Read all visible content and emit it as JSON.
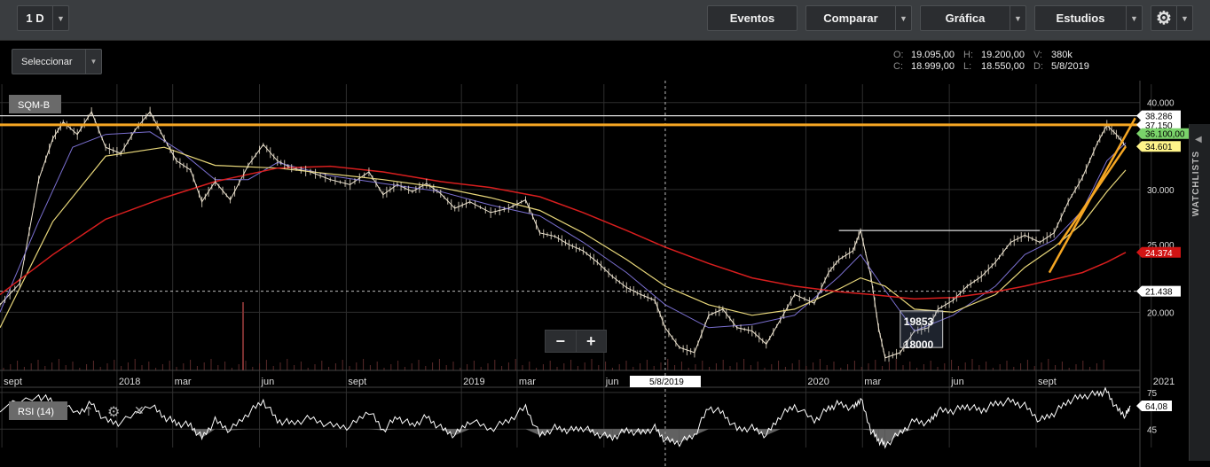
{
  "toolbar": {
    "interval": "1 D",
    "events": "Eventos",
    "compare": "Comparar",
    "chart": "Gráfica",
    "studies": "Estudios"
  },
  "selector": {
    "label": "Seleccionar"
  },
  "ohlc": {
    "o_label": "O:",
    "o": "19.095,00",
    "h_label": "H:",
    "h": "19.200,00",
    "v_label": "V:",
    "v": "380k",
    "c_label": "C:",
    "c": "18.999,00",
    "l_label": "L:",
    "l": "18.550,00",
    "d_label": "D:",
    "d": "5/8/2019"
  },
  "sidebar": {
    "label": "WATCHLISTS"
  },
  "colors": {
    "background": "#000000",
    "price": "#f0e6d2",
    "ma_short": "#7a6fd0",
    "ma_mid": "#e8d77a",
    "ma_long": "#d81e1e",
    "resistance": "#f5a623",
    "white_line": "#e0e0e0",
    "rsi_line": "#ffffff",
    "rsi_fill": "#8a8a8a"
  },
  "chart_data": {
    "type": "line",
    "symbol": "SQM-B",
    "y_ticks": [
      "40.000",
      "30.000",
      "25.000",
      "20.000"
    ],
    "y_tick_values": [
      40000,
      30000,
      25000,
      20000
    ],
    "ylim": [
      16500,
      42500
    ],
    "y_scale": "log",
    "x_ticks": [
      "sept",
      "2018",
      "mar",
      "jun",
      "sept",
      "2019",
      "mar",
      "jun",
      "2020",
      "mar",
      "jun",
      "sept",
      "2021"
    ],
    "x_tick_dates": [
      "2017-09-01",
      "2018-01-01",
      "2018-03-01",
      "2018-06-01",
      "2018-09-01",
      "2019-01-01",
      "2019-03-01",
      "2019-06-01",
      "2020-01-01",
      "2020-03-01",
      "2020-06-01",
      "2020-09-01",
      "2021-01-01"
    ],
    "xlim": [
      "2017-08-30",
      "2020-12-20"
    ],
    "crosshair": {
      "date": "5/8/2019",
      "value": "21.438"
    },
    "labels": [
      {
        "text": "38.286",
        "value": 38286,
        "style": "white"
      },
      {
        "text": "37.150",
        "value": 37150,
        "style": "white"
      },
      {
        "text": "36.100,00",
        "value": 36100,
        "style": "green"
      },
      {
        "text": "34.601",
        "value": 34601,
        "style": "yellow"
      },
      {
        "text": "24.374",
        "value": 24374,
        "style": "red"
      },
      {
        "text": "21.438",
        "value": 21438,
        "style": "white"
      }
    ],
    "series": [
      {
        "points": [
          [
            "2017-08-30",
            20500
          ],
          [
            "2017-09-20",
            22000
          ],
          [
            "2017-10-10",
            31000
          ],
          [
            "2017-10-25",
            35500
          ],
          [
            "2017-11-05",
            37500
          ],
          [
            "2017-11-20",
            36000
          ],
          [
            "2017-12-05",
            38800
          ],
          [
            "2017-12-20",
            34500
          ],
          [
            "2018-01-05",
            33800
          ],
          [
            "2018-01-20",
            36500
          ],
          [
            "2018-02-05",
            38800
          ],
          [
            "2018-02-20",
            35500
          ],
          [
            "2018-03-05",
            33000
          ],
          [
            "2018-03-20",
            32000
          ],
          [
            "2018-04-01",
            28800
          ],
          [
            "2018-04-15",
            30800
          ],
          [
            "2018-05-01",
            29000
          ],
          [
            "2018-05-20",
            32500
          ],
          [
            "2018-06-05",
            34800
          ],
          [
            "2018-06-20",
            33000
          ],
          [
            "2018-07-05",
            32200
          ],
          [
            "2018-07-25",
            31800
          ],
          [
            "2018-08-15",
            31000
          ],
          [
            "2018-09-05",
            30500
          ],
          [
            "2018-09-25",
            31800
          ],
          [
            "2018-10-10",
            29500
          ],
          [
            "2018-10-25",
            30500
          ],
          [
            "2018-11-10",
            29800
          ],
          [
            "2018-11-25",
            30600
          ],
          [
            "2018-12-10",
            29600
          ],
          [
            "2018-12-25",
            28200
          ],
          [
            "2019-01-10",
            28800
          ],
          [
            "2019-02-01",
            27800
          ],
          [
            "2019-02-20",
            28200
          ],
          [
            "2019-03-10",
            29000
          ],
          [
            "2019-03-25",
            26000
          ],
          [
            "2019-04-10",
            25700
          ],
          [
            "2019-04-25",
            25000
          ],
          [
            "2019-05-10",
            24500
          ],
          [
            "2019-05-25",
            23600
          ],
          [
            "2019-06-10",
            22500
          ],
          [
            "2019-06-25",
            21700
          ],
          [
            "2019-07-10",
            21200
          ],
          [
            "2019-07-25",
            20800
          ],
          [
            "2019-08-05",
            18999
          ],
          [
            "2019-08-20",
            17800
          ],
          [
            "2019-09-05",
            17500
          ],
          [
            "2019-09-20",
            19800
          ],
          [
            "2019-10-05",
            20200
          ],
          [
            "2019-10-20",
            19000
          ],
          [
            "2019-11-05",
            18800
          ],
          [
            "2019-11-20",
            18000
          ],
          [
            "2019-12-05",
            19500
          ],
          [
            "2019-12-20",
            21200
          ],
          [
            "2020-01-10",
            20600
          ],
          [
            "2020-01-25",
            22800
          ],
          [
            "2020-02-05",
            23800
          ],
          [
            "2020-02-20",
            24500
          ],
          [
            "2020-02-28",
            26200
          ],
          [
            "2020-03-10",
            22500
          ],
          [
            "2020-03-18",
            19000
          ],
          [
            "2020-03-25",
            17200
          ],
          [
            "2020-04-10",
            17500
          ],
          [
            "2020-04-25",
            18800
          ],
          [
            "2020-05-10",
            19000
          ],
          [
            "2020-05-20",
            20200
          ],
          [
            "2020-06-05",
            20800
          ],
          [
            "2020-06-20",
            21800
          ],
          [
            "2020-07-05",
            22500
          ],
          [
            "2020-07-20",
            23600
          ],
          [
            "2020-08-05",
            25200
          ],
          [
            "2020-08-20",
            25800
          ],
          [
            "2020-09-05",
            25200
          ],
          [
            "2020-09-20",
            26000
          ],
          [
            "2020-10-05",
            28800
          ],
          [
            "2020-10-20",
            31200
          ],
          [
            "2020-11-05",
            35000
          ],
          [
            "2020-11-15",
            37100
          ],
          [
            "2020-11-25",
            36000
          ],
          [
            "2020-12-05",
            34600
          ]
        ]
      },
      {
        "points": [
          [
            "2017-08-30",
            20000
          ],
          [
            "2017-10-10",
            27000
          ],
          [
            "2017-11-15",
            34500
          ],
          [
            "2017-12-20",
            36000
          ],
          [
            "2018-02-05",
            36300
          ],
          [
            "2018-03-10",
            34000
          ],
          [
            "2018-04-15",
            31000
          ],
          [
            "2018-05-20",
            31000
          ],
          [
            "2018-06-20",
            32800
          ],
          [
            "2018-08-15",
            31400
          ],
          [
            "2018-10-10",
            30600
          ],
          [
            "2018-12-10",
            29800
          ],
          [
            "2019-02-01",
            28500
          ],
          [
            "2019-03-25",
            27500
          ],
          [
            "2019-05-10",
            25200
          ],
          [
            "2019-06-25",
            22800
          ],
          [
            "2019-08-05",
            20500
          ],
          [
            "2019-09-20",
            19000
          ],
          [
            "2019-11-05",
            19200
          ],
          [
            "2019-12-20",
            19800
          ],
          [
            "2020-02-05",
            22500
          ],
          [
            "2020-02-28",
            24200
          ],
          [
            "2020-03-25",
            21500
          ],
          [
            "2020-04-25",
            18800
          ],
          [
            "2020-06-05",
            19800
          ],
          [
            "2020-07-20",
            21800
          ],
          [
            "2020-08-20",
            24200
          ],
          [
            "2020-09-20",
            25400
          ],
          [
            "2020-10-20",
            28000
          ],
          [
            "2020-11-15",
            33000
          ],
          [
            "2020-12-05",
            35000
          ]
        ]
      },
      {
        "points": [
          [
            "2017-08-30",
            19000
          ],
          [
            "2017-10-25",
            27000
          ],
          [
            "2017-12-20",
            33500
          ],
          [
            "2018-02-20",
            34500
          ],
          [
            "2018-04-15",
            32500
          ],
          [
            "2018-06-20",
            32200
          ],
          [
            "2018-08-15",
            31600
          ],
          [
            "2018-10-10",
            31000
          ],
          [
            "2018-12-10",
            30200
          ],
          [
            "2019-02-01",
            29200
          ],
          [
            "2019-03-25",
            28000
          ],
          [
            "2019-05-10",
            26000
          ],
          [
            "2019-06-25",
            23800
          ],
          [
            "2019-08-05",
            21800
          ],
          [
            "2019-09-20",
            20500
          ],
          [
            "2019-11-05",
            19800
          ],
          [
            "2019-12-20",
            20200
          ],
          [
            "2020-02-05",
            21600
          ],
          [
            "2020-02-28",
            22400
          ],
          [
            "2020-03-25",
            21800
          ],
          [
            "2020-04-25",
            20200
          ],
          [
            "2020-06-05",
            20000
          ],
          [
            "2020-07-20",
            21200
          ],
          [
            "2020-08-20",
            23200
          ],
          [
            "2020-09-20",
            24800
          ],
          [
            "2020-10-20",
            26800
          ],
          [
            "2020-11-15",
            29800
          ],
          [
            "2020-12-05",
            32000
          ]
        ]
      },
      {
        "points": [
          [
            "2017-08-30",
            21200
          ],
          [
            "2017-10-25",
            24200
          ],
          [
            "2017-12-20",
            27200
          ],
          [
            "2018-02-20",
            29200
          ],
          [
            "2018-04-15",
            30800
          ],
          [
            "2018-06-20",
            32200
          ],
          [
            "2018-08-15",
            32400
          ],
          [
            "2018-10-10",
            31800
          ],
          [
            "2018-12-10",
            30800
          ],
          [
            "2019-02-01",
            30200
          ],
          [
            "2019-03-25",
            29300
          ],
          [
            "2019-05-10",
            27800
          ],
          [
            "2019-06-25",
            26200
          ],
          [
            "2019-08-05",
            24800
          ],
          [
            "2019-09-20",
            23500
          ],
          [
            "2019-11-05",
            22400
          ],
          [
            "2019-12-20",
            21800
          ],
          [
            "2020-02-05",
            21400
          ],
          [
            "2020-03-10",
            21200
          ],
          [
            "2020-04-25",
            20900
          ],
          [
            "2020-06-05",
            21000
          ],
          [
            "2020-07-20",
            21400
          ],
          [
            "2020-08-20",
            21800
          ],
          [
            "2020-09-20",
            22300
          ],
          [
            "2020-10-20",
            22800
          ],
          [
            "2020-11-15",
            23600
          ],
          [
            "2020-12-05",
            24374
          ]
        ]
      }
    ],
    "drawings": {
      "resistance_level": 37150,
      "white_levels": [
        38286
      ],
      "range_line": {
        "value": 26200,
        "from": "2020-02-05",
        "to": "2020-09-05"
      },
      "trendline": {
        "from": [
          "2020-09-15",
          22800
        ],
        "to": [
          "2020-12-15",
          38000
        ]
      },
      "box_labels": [
        "19853",
        "18000"
      ]
    }
  },
  "rsi": {
    "label": "RSI (14)",
    "value_label": "64,08",
    "levels": [
      75,
      45
    ],
    "level_labels": [
      "75",
      "45"
    ],
    "ylim": [
      30,
      80
    ],
    "points": [
      [
        "2017-08-30",
        62
      ],
      [
        "2017-10-10",
        72
      ],
      [
        "2017-10-25",
        68
      ],
      [
        "2017-11-20",
        58
      ],
      [
        "2017-12-05",
        66
      ],
      [
        "2017-12-20",
        52
      ],
      [
        "2018-01-05",
        50
      ],
      [
        "2018-02-05",
        65
      ],
      [
        "2018-02-20",
        55
      ],
      [
        "2018-03-05",
        50
      ],
      [
        "2018-03-20",
        48
      ],
      [
        "2018-04-01",
        38
      ],
      [
        "2018-04-15",
        52
      ],
      [
        "2018-05-01",
        44
      ],
      [
        "2018-05-20",
        58
      ],
      [
        "2018-06-05",
        68
      ],
      [
        "2018-06-20",
        52
      ],
      [
        "2018-07-05",
        50
      ],
      [
        "2018-07-25",
        54
      ],
      [
        "2018-08-15",
        48
      ],
      [
        "2018-09-05",
        47
      ],
      [
        "2018-09-25",
        60
      ],
      [
        "2018-10-10",
        44
      ],
      [
        "2018-10-25",
        55
      ],
      [
        "2018-11-10",
        48
      ],
      [
        "2018-11-25",
        55
      ],
      [
        "2018-12-10",
        46
      ],
      [
        "2018-12-25",
        40
      ],
      [
        "2019-01-10",
        52
      ],
      [
        "2019-02-01",
        45
      ],
      [
        "2019-02-20",
        52
      ],
      [
        "2019-03-10",
        63
      ],
      [
        "2019-03-25",
        40
      ],
      [
        "2019-04-10",
        46
      ],
      [
        "2019-04-25",
        44
      ],
      [
        "2019-05-10",
        46
      ],
      [
        "2019-05-25",
        41
      ],
      [
        "2019-06-10",
        38
      ],
      [
        "2019-06-25",
        44
      ],
      [
        "2019-07-10",
        42
      ],
      [
        "2019-07-25",
        46
      ],
      [
        "2019-08-05",
        36
      ],
      [
        "2019-08-20",
        34
      ],
      [
        "2019-09-05",
        40
      ],
      [
        "2019-09-20",
        63
      ],
      [
        "2019-10-05",
        58
      ],
      [
        "2019-10-20",
        45
      ],
      [
        "2019-11-05",
        46
      ],
      [
        "2019-11-20",
        40
      ],
      [
        "2019-12-05",
        56
      ],
      [
        "2019-12-20",
        64
      ],
      [
        "2020-01-10",
        52
      ],
      [
        "2020-01-25",
        62
      ],
      [
        "2020-02-05",
        66
      ],
      [
        "2020-02-20",
        62
      ],
      [
        "2020-02-28",
        70
      ],
      [
        "2020-03-10",
        44
      ],
      [
        "2020-03-18",
        36
      ],
      [
        "2020-03-25",
        32
      ],
      [
        "2020-04-10",
        42
      ],
      [
        "2020-04-25",
        52
      ],
      [
        "2020-05-10",
        50
      ],
      [
        "2020-05-20",
        60
      ],
      [
        "2020-06-05",
        60
      ],
      [
        "2020-06-20",
        64
      ],
      [
        "2020-07-05",
        60
      ],
      [
        "2020-07-20",
        66
      ],
      [
        "2020-08-05",
        68
      ],
      [
        "2020-08-20",
        64
      ],
      [
        "2020-09-05",
        52
      ],
      [
        "2020-09-20",
        58
      ],
      [
        "2020-10-05",
        68
      ],
      [
        "2020-10-20",
        72
      ],
      [
        "2020-11-05",
        74
      ],
      [
        "2020-11-15",
        76
      ],
      [
        "2020-11-25",
        62
      ],
      [
        "2020-12-05",
        56
      ],
      [
        "2020-12-10",
        64
      ]
    ]
  }
}
